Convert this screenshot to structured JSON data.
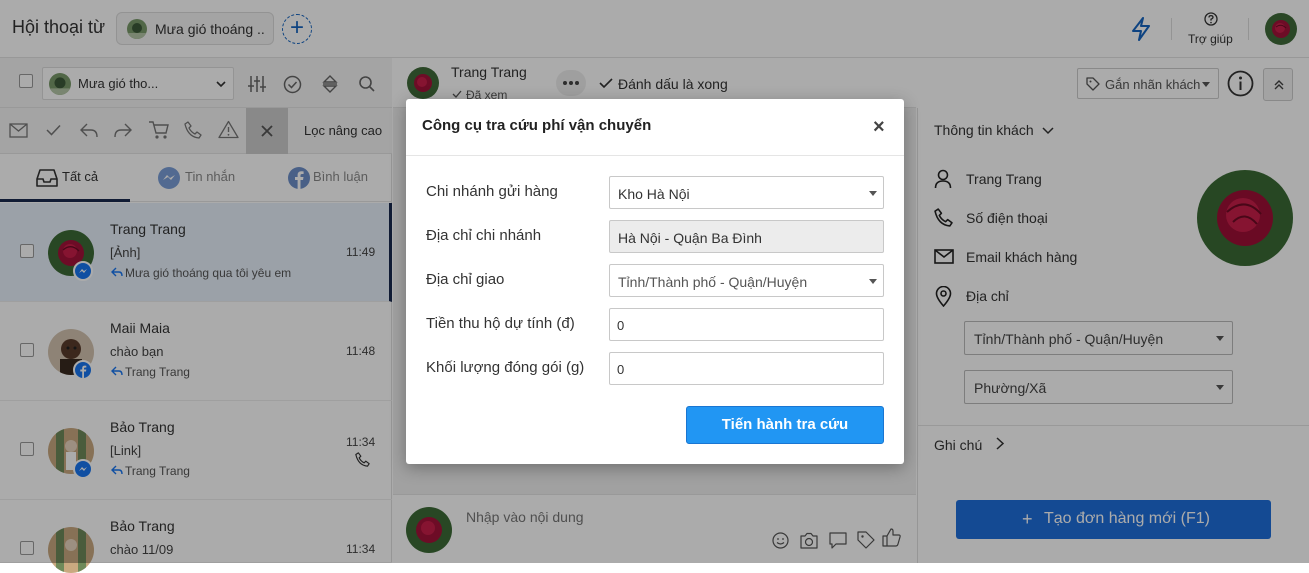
{
  "app": {
    "title": "Hội thoại từ",
    "page_name": "Mưa gió thoáng ..",
    "help_label": "Trợ giúp"
  },
  "left": {
    "page_filter": "Mưa gió tho...",
    "advanced_filter": "Lọc nâng cao",
    "tabs": [
      {
        "label": "Tất cả"
      },
      {
        "label": "Tin nhắn"
      },
      {
        "label": "Bình luận"
      }
    ],
    "conversations": [
      {
        "name": "Trang Trang",
        "message": "[Ảnh]",
        "reply": "Mưa gió thoáng qua tôi yêu em",
        "time": "11:49",
        "channel": "messenger"
      },
      {
        "name": "Maii Maia",
        "message": "chào bạn",
        "reply": "Trang Trang",
        "time": "11:48",
        "channel": "facebook"
      },
      {
        "name": "Bảo Trang",
        "message": "[Link]",
        "reply": "Trang Trang",
        "time": "11:34",
        "channel": "messenger"
      },
      {
        "name": "Bảo Trang",
        "message": "chào 11/09",
        "reply": "",
        "time": "11:34",
        "channel": "messenger"
      }
    ]
  },
  "chat": {
    "contact_name": "Trang Trang",
    "seen_status": "Đã xem",
    "mark_done_label": "Đánh dấu là xong",
    "tag_button": "Gắn nhãn khách",
    "composer_placeholder": "Nhập vào nội dung"
  },
  "customer": {
    "section_title": "Thông tin khách",
    "name": "Trang Trang",
    "phone_placeholder": "Số điện thoại",
    "email_placeholder": "Email khách hàng",
    "address_label": "Địa chỉ",
    "province_placeholder": "Tỉnh/Thành phố - Quận/Huyện",
    "ward_placeholder": "Phường/Xã",
    "notes_label": "Ghi chú",
    "create_order_label": "Tạo đơn hàng mới (F1)"
  },
  "modal": {
    "title": "Công cụ tra cứu phí vận chuyển",
    "fields": {
      "branch": {
        "label": "Chi nhánh gửi hàng",
        "value": "Kho Hà Nội"
      },
      "branch_address": {
        "label": "Địa chỉ chi nhánh",
        "value": "Hà Nội - Quận Ba Đình"
      },
      "delivery_address": {
        "label": "Địa chỉ giao",
        "value": "Tỉnh/Thành phố - Quận/Huyện"
      },
      "cod": {
        "label": "Tiền thu hộ dự tính (đ)",
        "value": "0"
      },
      "weight": {
        "label": "Khối lượng đóng gói (g)",
        "value": "0"
      }
    },
    "submit_label": "Tiến hành tra cứu"
  },
  "colors": {
    "accent": "#1565c0",
    "button_blue": "#2196f3",
    "overlay": "rgba(0,0,0,0.33)"
  }
}
